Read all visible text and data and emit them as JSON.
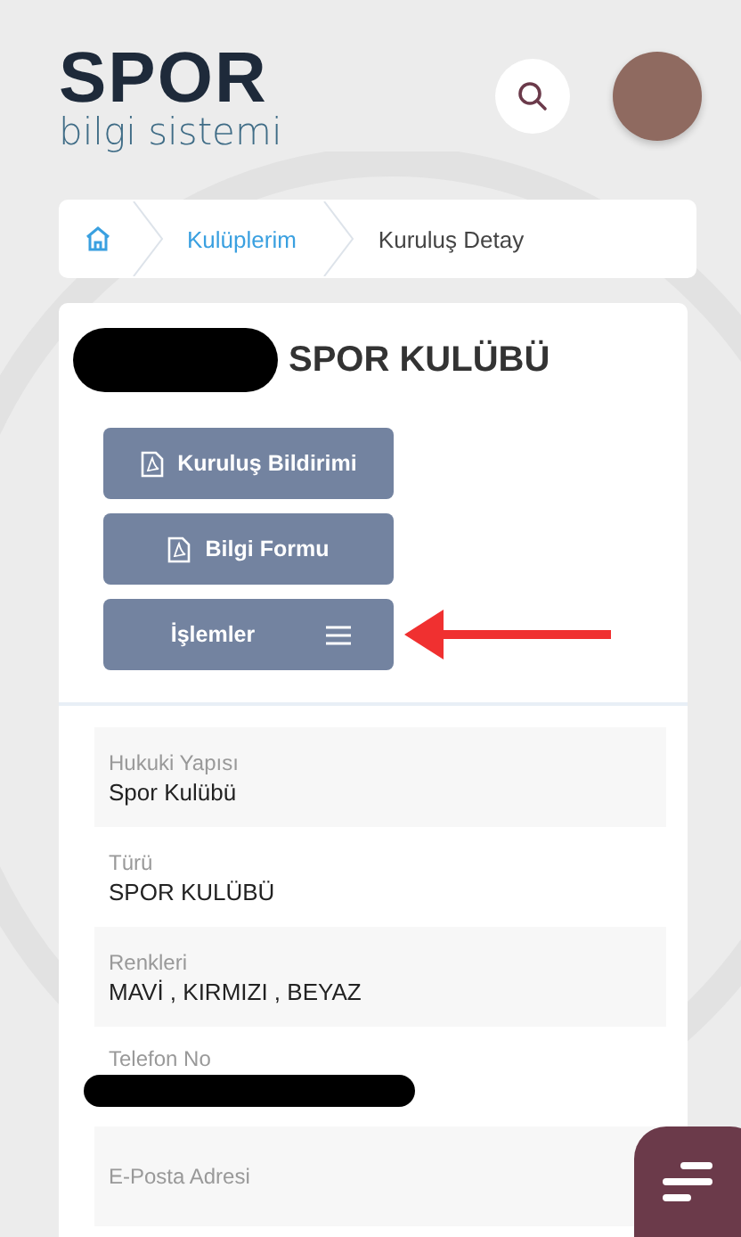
{
  "header": {
    "logo": "SPOR",
    "tagline": "bilgi sistemi"
  },
  "breadcrumb": [
    {
      "label": "Kulüplerim",
      "current": false
    },
    {
      "label": "Kuruluş Detay",
      "current": true
    }
  ],
  "club": {
    "title": "SPOR KULÜBÜ",
    "name_redacted": true
  },
  "buttons": [
    {
      "label": "Kuruluş Bildirimi",
      "kind": "pdf"
    },
    {
      "label": "Bilgi Formu",
      "kind": "pdf"
    },
    {
      "label": "İşlemler",
      "kind": "menu"
    }
  ],
  "fields": [
    {
      "label": "Hukuki Yapısı",
      "value": "Spor Kulübü",
      "redacted": false
    },
    {
      "label": "Türü",
      "value": "SPOR KULÜBÜ",
      "redacted": false
    },
    {
      "label": "Renkleri",
      "value": "MAVİ , KIRMIZI , BEYAZ",
      "redacted": false
    },
    {
      "label": "Telefon No",
      "redacted": true
    },
    {
      "label": "E-Posta Adresi",
      "redacted": false
    }
  ]
}
